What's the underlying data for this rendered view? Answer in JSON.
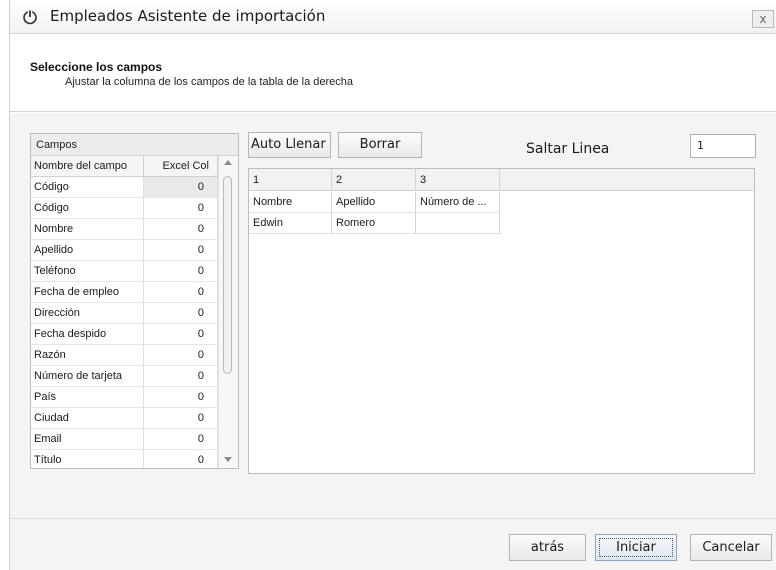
{
  "window": {
    "title": "Empleados Asistente de importación",
    "close_glyph": "x",
    "app_icon": "power-icon"
  },
  "header": {
    "title": "Seleccione los campos",
    "subtitle": "Ajustar la columna de los campos de la tabla de la derecha"
  },
  "fields": {
    "caption": "Campos",
    "col_name": "Nombre del campo",
    "col_excel": "Excel Col",
    "rows": [
      {
        "name": "Código",
        "value": "0"
      },
      {
        "name": "Código",
        "value": "0"
      },
      {
        "name": "Nombre",
        "value": "0"
      },
      {
        "name": "Apellido",
        "value": "0"
      },
      {
        "name": "Teléfono",
        "value": "0"
      },
      {
        "name": "Fecha de empleo",
        "value": "0"
      },
      {
        "name": "Dirección",
        "value": "0"
      },
      {
        "name": "Fecha despido",
        "value": "0"
      },
      {
        "name": "Razón",
        "value": "0"
      },
      {
        "name": "Número de tarjeta",
        "value": "0"
      },
      {
        "name": "País",
        "value": "0"
      },
      {
        "name": "Ciudad",
        "value": "0"
      },
      {
        "name": "Email",
        "value": "0"
      },
      {
        "name": "Título",
        "value": "0"
      }
    ]
  },
  "toolbar": {
    "auto_fill": "Auto Llenar",
    "clear": "Borrar"
  },
  "skip_line": {
    "label": "Saltar Linea",
    "value": "1"
  },
  "preview": {
    "headers": [
      "1",
      "2",
      "3"
    ],
    "rows": [
      [
        "Nombre",
        "Apellido",
        "Número de ..."
      ],
      [
        "Edwin",
        "Romero",
        ""
      ]
    ]
  },
  "footer": {
    "back": "atrás",
    "start": "Iniciar",
    "cancel": "Cancelar"
  }
}
